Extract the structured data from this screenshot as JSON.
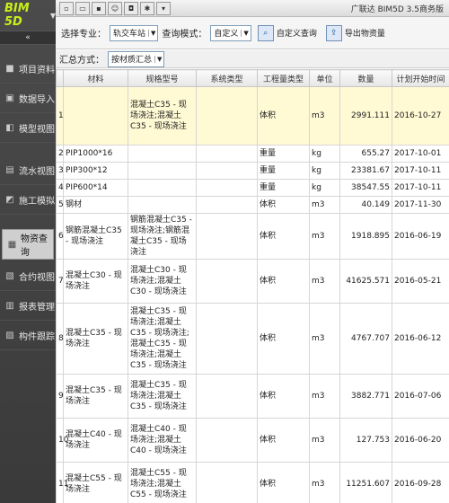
{
  "sidebar": {
    "logo": "BIM 5D",
    "collapse": "«",
    "items": [
      {
        "label": "项目资料",
        "icon": "folder-icon"
      },
      {
        "label": "数据导入",
        "icon": "import-icon"
      },
      {
        "label": "模型视图",
        "icon": "model-icon"
      },
      {
        "label": "流水视图",
        "icon": "flow-icon"
      },
      {
        "label": "施工模拟",
        "icon": "simulation-icon"
      },
      {
        "label": "物资查询",
        "icon": "material-icon"
      },
      {
        "label": "合约视图",
        "icon": "contract-icon"
      },
      {
        "label": "报表管理",
        "icon": "report-icon"
      },
      {
        "label": "构件跟踪",
        "icon": "tracking-icon"
      }
    ]
  },
  "titlebar": {
    "title": "广联达 BIM5D 3.5商务版"
  },
  "filters": {
    "major_label": "选择专业：",
    "major_value": "轨交车站",
    "mode_label": "查询模式：",
    "mode_value": "自定义",
    "custom_query": "自定义查询",
    "export": "导出物资量",
    "group_label": "汇总方式：",
    "group_value": "按材质汇总"
  },
  "table": {
    "headers": [
      "",
      "材料",
      "规格型号",
      "系统类型",
      "工程量类型",
      "单位",
      "数量",
      "计划开始时间"
    ],
    "rows": [
      {
        "idx": "1",
        "material": "",
        "spec": "混凝土C35 - 现场浇注;混凝土C35 - 现场浇注",
        "system": "",
        "qtype": "体积",
        "unit": "m3",
        "qty": "2991.111",
        "date": "2016-10-27"
      },
      {
        "idx": "2",
        "material": "PIP1000*16",
        "spec": "",
        "system": "",
        "qtype": "重量",
        "unit": "kg",
        "qty": "655.27",
        "date": "2017-10-01"
      },
      {
        "idx": "3",
        "material": "PIP300*12",
        "spec": "",
        "system": "",
        "qtype": "重量",
        "unit": "kg",
        "qty": "23381.67",
        "date": "2017-10-11"
      },
      {
        "idx": "4",
        "material": "PIP600*14",
        "spec": "",
        "system": "",
        "qtype": "重量",
        "unit": "kg",
        "qty": "38547.55",
        "date": "2017-10-11"
      },
      {
        "idx": "5",
        "material": "钢材",
        "spec": "",
        "system": "",
        "qtype": "体积",
        "unit": "m3",
        "qty": "40.149",
        "date": "2017-11-30"
      },
      {
        "idx": "6",
        "material": "钢筋混凝土C35 - 现场浇注",
        "spec": "钢筋混凝土C35 - 现场浇注;钢筋混凝土C35 - 现场浇注",
        "system": "",
        "qtype": "体积",
        "unit": "m3",
        "qty": "1918.895",
        "date": "2016-06-19"
      },
      {
        "idx": "7",
        "material": "混凝土C30 - 现场浇注",
        "spec": "混凝土C30 - 现场浇注;混凝土C30 - 现场浇注",
        "system": "",
        "qtype": "体积",
        "unit": "m3",
        "qty": "41625.571",
        "date": "2016-05-21"
      },
      {
        "idx": "8",
        "material": "混凝土C35 - 现场浇注",
        "spec": "混凝土C35 - 现场浇注;混凝土C35 - 现场浇注;混凝土C35 - 现场浇注;混凝土C35 - 现场浇注",
        "system": "",
        "qtype": "体积",
        "unit": "m3",
        "qty": "4767.707",
        "date": "2016-06-12"
      },
      {
        "idx": "9",
        "material": "混凝土C35 - 现场浇注",
        "spec": "混凝土C35 - 现场浇注;混凝土C35 - 现场浇注",
        "system": "",
        "qtype": "体积",
        "unit": "m3",
        "qty": "3882.771",
        "date": "2016-07-06"
      },
      {
        "idx": "10",
        "material": "混凝土C40 - 现场浇注",
        "spec": "混凝土C40 - 现场浇注;混凝土C40 - 现场浇注",
        "system": "",
        "qtype": "体积",
        "unit": "m3",
        "qty": "127.753",
        "date": "2016-06-20"
      },
      {
        "idx": "11",
        "material": "混凝土C55 - 现场浇注",
        "spec": "混凝土C55 - 现场浇注;混凝土C55 - 现场浇注",
        "system": "",
        "qtype": "体积",
        "unit": "m3",
        "qty": "11251.607",
        "date": "2016-09-28"
      }
    ]
  }
}
